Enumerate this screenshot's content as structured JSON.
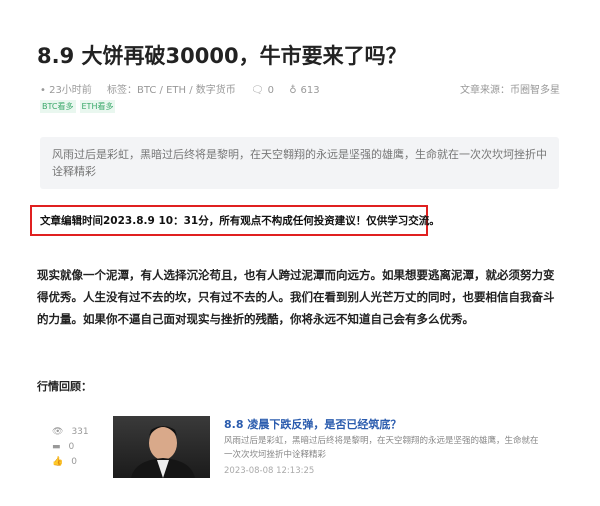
{
  "article": {
    "title": "8.9 大饼再破30000，牛市要来了吗？",
    "time": "23小时前",
    "tags_label": "标签：BTC / ETH / 数字货币",
    "comments": "0",
    "views": "613",
    "source": "文章来源：币圈智多星",
    "badges": [
      "BTC看多",
      "ETH看多"
    ],
    "quote": "风雨过后是彩虹，黑暗过后终将是黎明，在天空翱翔的永远是坚强的雄鹰，生命就在一次次坎坷挫折中诠释精彩",
    "notice": "文章编辑时间2023.8.9 10：31分，所有观点不构成任何投资建议！仅供学习交流。",
    "body": "现实就像一个泥潭，有人选择沉沦苟且，也有人跨过泥潭而向远方。如果想要逃离泥潭，就必须努力变得优秀。人生没有过不去的坎，只有过不去的人。我们在看到别人光芒万丈的同时，也要相信自我奋斗的力量。如果你不逼自己面对现实与挫折的残酷，你将永远不知道自己会有多么优秀。",
    "review_label": "行情回顾："
  },
  "related": {
    "views": "331",
    "comments": "0",
    "likes": "0",
    "title": "8.8 凌晨下跌反弹，是否已经筑底？",
    "desc": "风雨过后是彩虹，黑暗过后终将是黎明，在天空翱翔的永远是坚强的雄鹰，生命就在一次次坎坷挫折中诠释精彩",
    "date": "2023-08-08 12:13:25"
  }
}
